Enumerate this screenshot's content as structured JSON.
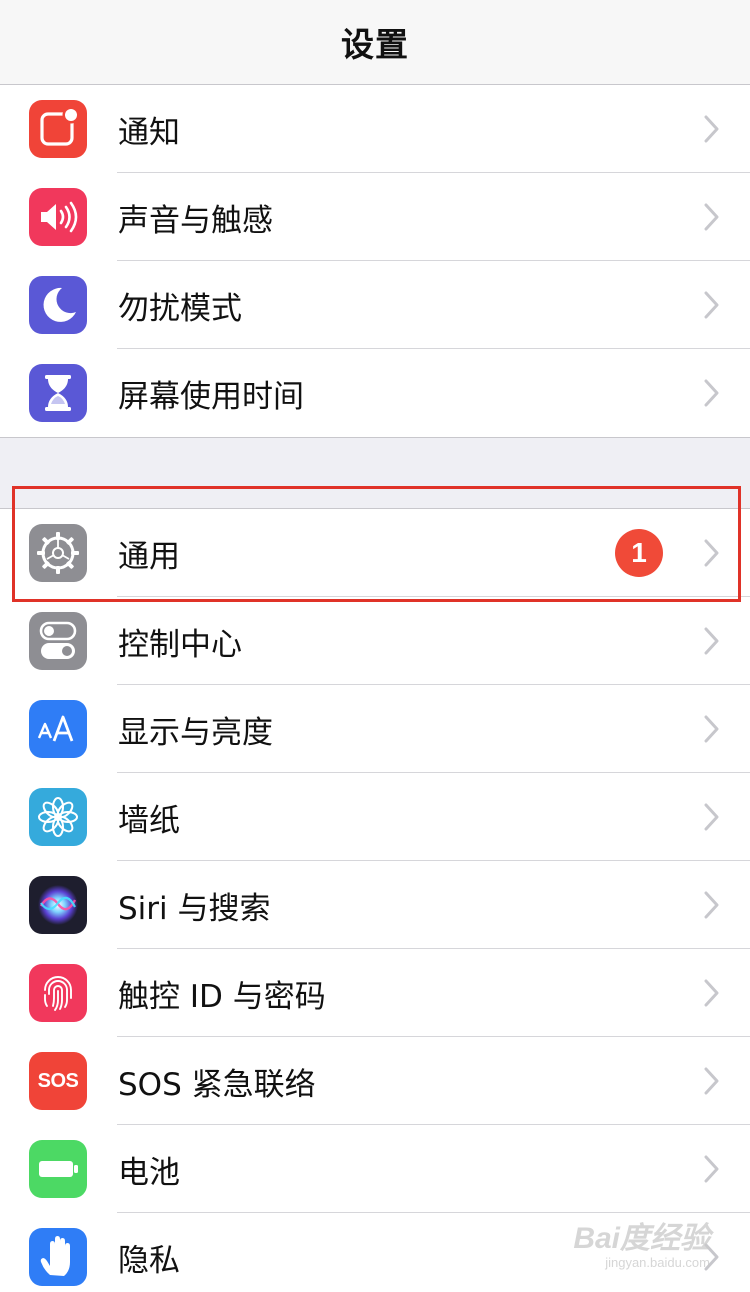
{
  "header": {
    "title": "设置"
  },
  "groups": [
    {
      "items": [
        {
          "label": "通知",
          "icon": "notifications-icon",
          "color": "#f04438"
        },
        {
          "label": "声音与触感",
          "icon": "sounds-icon",
          "color": "#f1385c"
        },
        {
          "label": "勿扰模式",
          "icon": "moon-icon",
          "color": "#5a58d6"
        },
        {
          "label": "屏幕使用时间",
          "icon": "hourglass-icon",
          "color": "#5a58d6"
        }
      ]
    },
    {
      "items": [
        {
          "label": "通用",
          "icon": "gear-icon",
          "color": "#8e8e93",
          "badge": "1"
        },
        {
          "label": "控制中心",
          "icon": "toggles-icon",
          "color": "#8e8e93"
        },
        {
          "label": "显示与亮度",
          "icon": "text-size-icon",
          "color": "#2f7df6"
        },
        {
          "label": "墙纸",
          "icon": "flower-icon",
          "color": "#35aadc"
        },
        {
          "label": "Siri 与搜索",
          "icon": "siri-icon",
          "color": "#222233"
        },
        {
          "label": "触控 ID 与密码",
          "icon": "fingerprint-icon",
          "color": "#f1385c"
        },
        {
          "label": "SOS 紧急联络",
          "icon": "sos-icon",
          "color": "#f04438",
          "icon_text": "SOS"
        },
        {
          "label": "电池",
          "icon": "battery-icon",
          "color": "#4cd964"
        },
        {
          "label": "隐私",
          "icon": "hand-icon",
          "color": "#2f7df6"
        }
      ]
    }
  ],
  "highlight": {
    "target": "通用",
    "color": "#e03228"
  },
  "watermark": {
    "main": "Bai度经验",
    "sub": "jingyan.baidu.com"
  }
}
